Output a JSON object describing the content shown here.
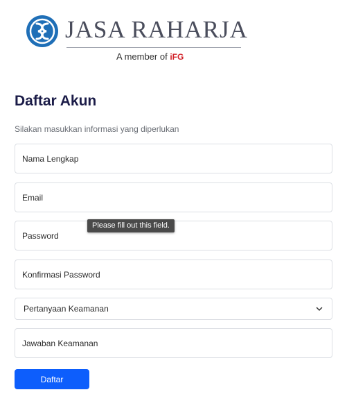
{
  "brand": {
    "name": "JASA RAHARJA",
    "tagline_prefix": "A member of",
    "parent_logo_text": "iFG",
    "text_color": "#4a4d5c",
    "emblem_color": "#1f6fb7",
    "parent_logo_color": "#d2232a"
  },
  "form": {
    "title": "Daftar Akun",
    "subtitle": "Silakan masukkan informasi yang diperlukan",
    "fields": {
      "full_name_placeholder": "Nama Lengkap",
      "email_placeholder": "Email",
      "password_placeholder": "Password",
      "confirm_password_placeholder": "Konfirmasi Password",
      "security_question_selected": "Pertanyaan Keamanan",
      "security_answer_placeholder": "Jawaban Keamanan"
    },
    "validation_tooltip": "Please fill out this field.",
    "submit_label": "Daftar",
    "accent_color": "#0d5efc"
  }
}
